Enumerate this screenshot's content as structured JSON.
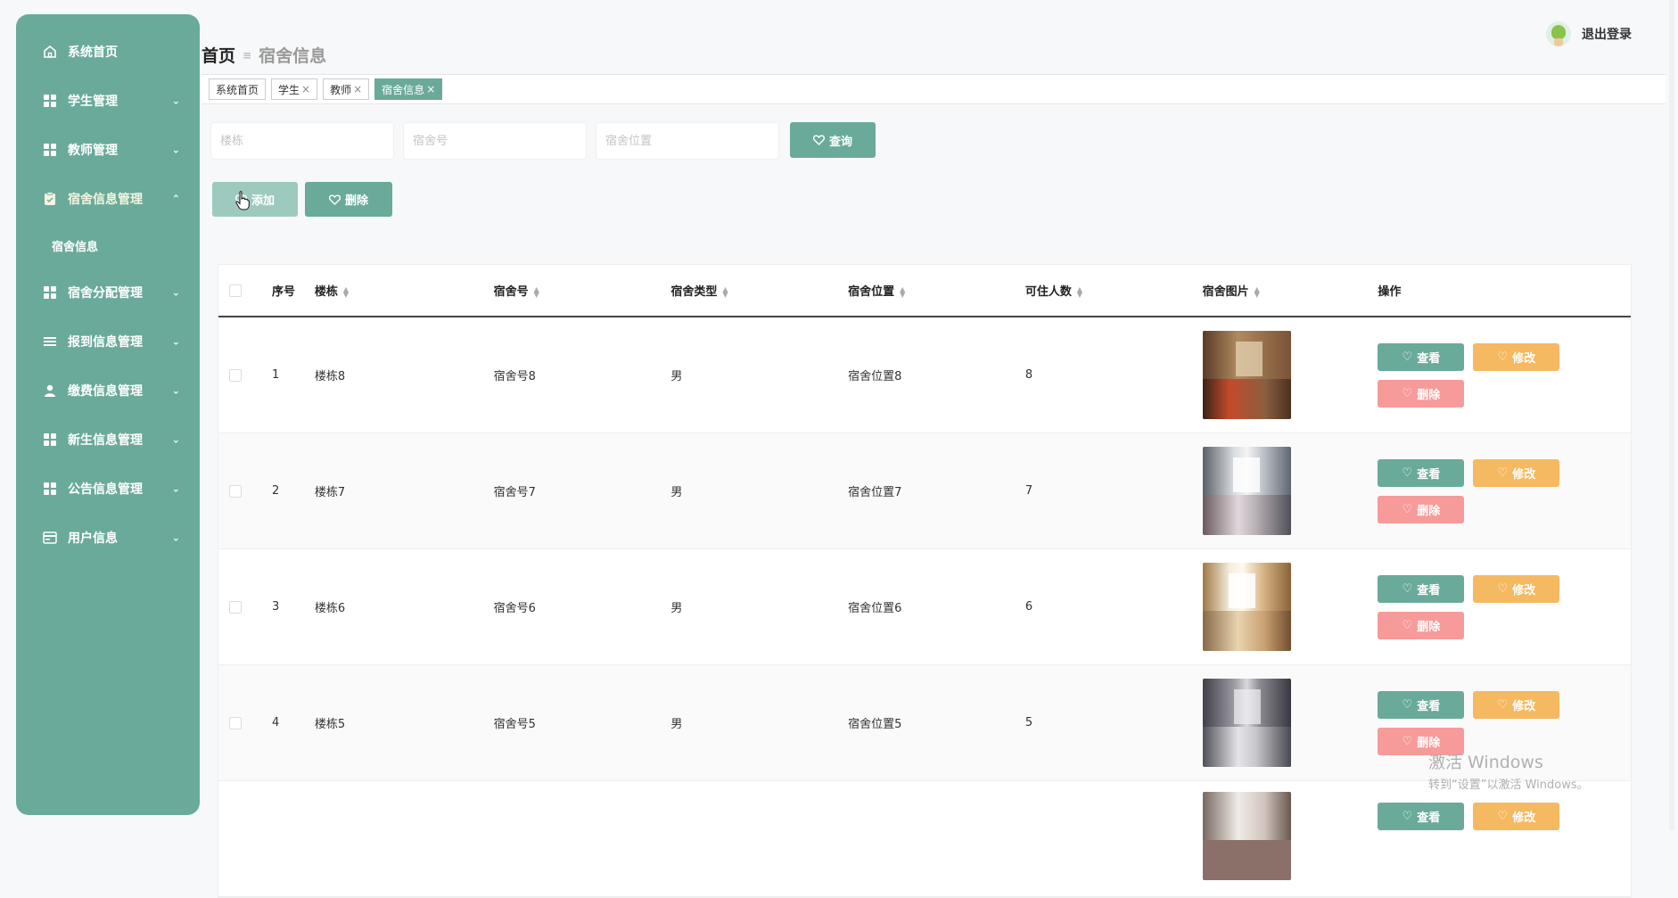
{
  "sidebar": {
    "items": [
      {
        "label": "系统首页",
        "icon": "home-icon"
      },
      {
        "label": "学生管理",
        "icon": "grid-icon"
      },
      {
        "label": "教师管理",
        "icon": "grid-icon"
      },
      {
        "label": "宿舍信息管理",
        "icon": "clipboard-icon"
      },
      {
        "label": "宿舍分配管理",
        "icon": "grid-icon"
      },
      {
        "label": "报到信息管理",
        "icon": "list-icon"
      },
      {
        "label": "缴费信息管理",
        "icon": "user-icon"
      },
      {
        "label": "新生信息管理",
        "icon": "grid-icon"
      },
      {
        "label": "公告信息管理",
        "icon": "grid-icon"
      },
      {
        "label": "用户信息",
        "icon": "card-icon"
      }
    ],
    "sub_item": "宿舍信息"
  },
  "breadcrumb": {
    "home": "首页",
    "current": "宿舍信息"
  },
  "header": {
    "logout": "退出登录"
  },
  "tabs": [
    {
      "label": "系统首页",
      "closable": false
    },
    {
      "label": "学生",
      "closable": true
    },
    {
      "label": "教师",
      "closable": true
    },
    {
      "label": "宿舍信息",
      "closable": true
    }
  ],
  "search": {
    "building_placeholder": "楼栋",
    "room_placeholder": "宿舍号",
    "location_placeholder": "宿舍位置",
    "query_label": "查询"
  },
  "toolbar": {
    "add_label": "添加",
    "delete_label": "删除"
  },
  "table": {
    "headers": [
      "序号",
      "楼栋",
      "宿舍号",
      "宿舍类型",
      "宿舍位置",
      "可住人数",
      "宿舍图片",
      "操作"
    ],
    "rows": [
      {
        "idx": "1",
        "building": "楼栋8",
        "room": "宿舍号8",
        "type": "男",
        "location": "宿舍位置8",
        "capacity": "8"
      },
      {
        "idx": "2",
        "building": "楼栋7",
        "room": "宿舍号7",
        "type": "男",
        "location": "宿舍位置7",
        "capacity": "7"
      },
      {
        "idx": "3",
        "building": "楼栋6",
        "room": "宿舍号6",
        "type": "男",
        "location": "宿舍位置6",
        "capacity": "6"
      },
      {
        "idx": "4",
        "building": "楼栋5",
        "room": "宿舍号5",
        "type": "男",
        "location": "宿舍位置5",
        "capacity": "5"
      },
      {
        "idx": "",
        "building": "",
        "room": "",
        "type": "",
        "location": "",
        "capacity": ""
      }
    ],
    "ops": {
      "view": "查看",
      "edit": "修改",
      "delete": "删除"
    }
  },
  "watermark": {
    "line1": "激活 Windows",
    "line2": "转到“设置”以激活 Windows。"
  },
  "colors": {
    "primary": "#6aaa9a",
    "edit": "#f5b961",
    "delete": "#f79a9a"
  }
}
